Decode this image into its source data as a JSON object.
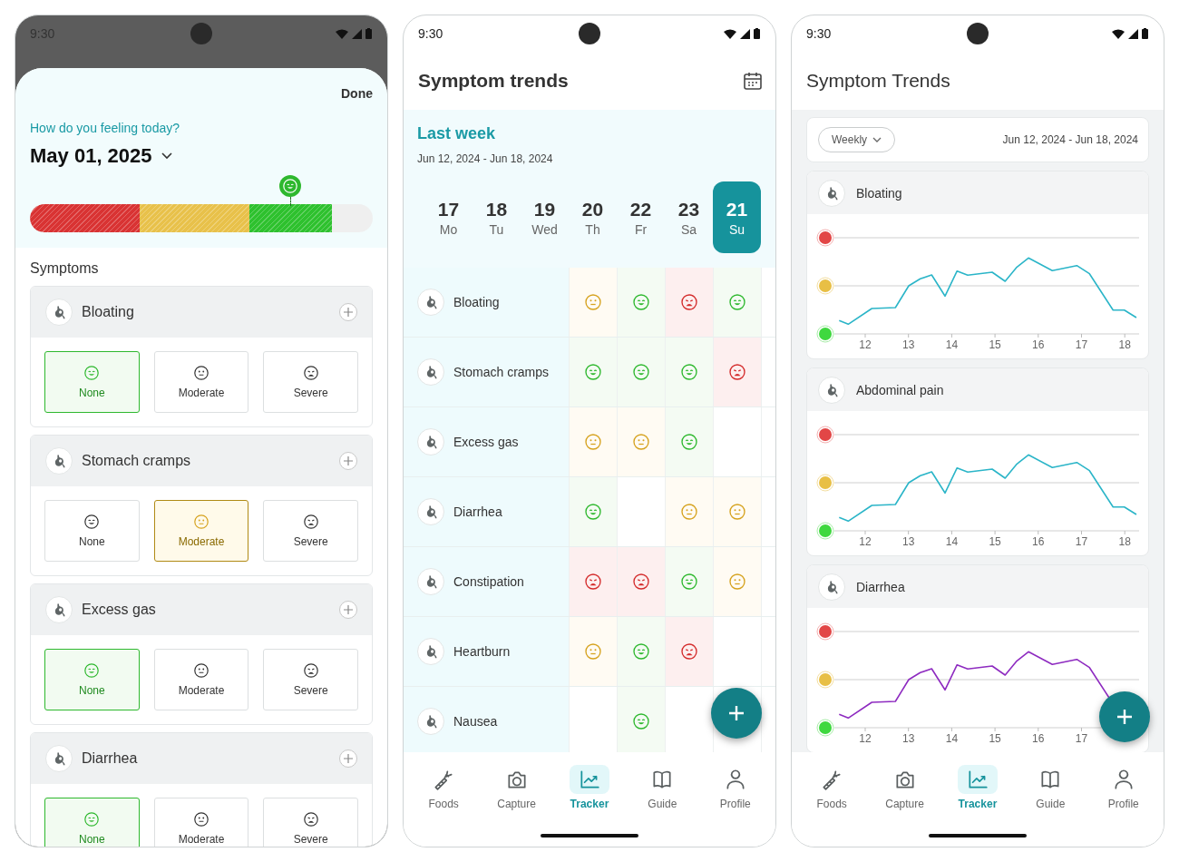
{
  "log_screen": {
    "status_bar": {
      "time": "9:30"
    },
    "done_button": "Done",
    "prompt": "How do you feeling today?",
    "date": "May 01, 2025",
    "mood_bar": {
      "level": 0.88
    },
    "section_title": "Symptoms",
    "symptoms": [
      {
        "name": "Bloating",
        "options": [
          {
            "kind": "none",
            "label": "None",
            "selected": true
          },
          {
            "kind": "moderate",
            "label": "Moderate",
            "selected": false
          },
          {
            "kind": "severe",
            "label": "Severe",
            "selected": false
          }
        ]
      },
      {
        "name": "Stomach cramps",
        "options": [
          {
            "kind": "none",
            "label": "None",
            "selected": false
          },
          {
            "kind": "moderate",
            "label": "Moderate",
            "selected": true
          },
          {
            "kind": "severe",
            "label": "Severe",
            "selected": false
          }
        ]
      },
      {
        "name": "Excess gas",
        "options": [
          {
            "kind": "none",
            "label": "None",
            "selected": true
          },
          {
            "kind": "moderate",
            "label": "Moderate",
            "selected": false
          },
          {
            "kind": "severe",
            "label": "Severe",
            "selected": false
          }
        ]
      },
      {
        "name": "Diarrhea",
        "options": [
          {
            "kind": "none",
            "label": "None",
            "selected": true
          },
          {
            "kind": "moderate",
            "label": "Moderate",
            "selected": false
          },
          {
            "kind": "severe",
            "label": "Severe",
            "selected": false
          }
        ]
      }
    ]
  },
  "grid_screen": {
    "status_bar": {
      "time": "9:30"
    },
    "title": "Symptom trends",
    "period_title": "Last week",
    "date_range": "Jun 12, 2024 - Jun 18, 2024",
    "days": [
      {
        "number": "17",
        "weekday": "Mo",
        "selected": false
      },
      {
        "number": "18",
        "weekday": "Tu",
        "selected": false
      },
      {
        "number": "19",
        "weekday": "Wed",
        "selected": false
      },
      {
        "number": "20",
        "weekday": "Th",
        "selected": false
      },
      {
        "number": "22",
        "weekday": "Fr",
        "selected": false
      },
      {
        "number": "23",
        "weekday": "Sa",
        "selected": false
      },
      {
        "number": "21",
        "weekday": "Su",
        "selected": true
      }
    ],
    "rows": [
      {
        "name": "Bloating",
        "cells": [
          {
            "kind": "moderate"
          },
          {
            "kind": "good"
          },
          {
            "kind": "severe"
          },
          {
            "kind": "good"
          }
        ]
      },
      {
        "name": "Stomach cramps",
        "cells": [
          {
            "kind": "good"
          },
          {
            "kind": "good"
          },
          {
            "kind": "good"
          },
          {
            "kind": "severe"
          }
        ]
      },
      {
        "name": "Excess gas",
        "cells": [
          {
            "kind": "moderate"
          },
          {
            "kind": "moderate"
          },
          {
            "kind": "good"
          },
          {
            "kind": "empty"
          }
        ]
      },
      {
        "name": "Diarrhea",
        "cells": [
          {
            "kind": "good"
          },
          {
            "kind": "empty"
          },
          {
            "kind": "moderate"
          },
          {
            "kind": "moderate"
          }
        ]
      },
      {
        "name": "Constipation",
        "cells": [
          {
            "kind": "severe"
          },
          {
            "kind": "severe"
          },
          {
            "kind": "good"
          },
          {
            "kind": "moderate"
          }
        ]
      },
      {
        "name": "Heartburn",
        "cells": [
          {
            "kind": "moderate"
          },
          {
            "kind": "good"
          },
          {
            "kind": "severe"
          },
          {
            "kind": "empty"
          }
        ]
      },
      {
        "name": "Nausea",
        "cells": [
          {
            "kind": "empty"
          },
          {
            "kind": "good"
          },
          {
            "kind": "empty"
          },
          {
            "kind": "empty"
          }
        ]
      }
    ],
    "nav": [
      {
        "kind": "foods",
        "label": "Foods",
        "selected": false
      },
      {
        "kind": "capture",
        "label": "Capture",
        "selected": false
      },
      {
        "kind": "tracker",
        "label": "Tracker",
        "selected": true
      },
      {
        "kind": "guide",
        "label": "Guide",
        "selected": false
      },
      {
        "kind": "profile",
        "label": "Profile",
        "selected": false
      }
    ]
  },
  "chart_screen": {
    "status_bar": {
      "time": "9:30"
    },
    "title": "Symptom Trends",
    "filter": {
      "period": "Weekly",
      "date_range": "Jun 12, 2024 - Jun 18, 2024"
    },
    "charts": [
      {
        "name": "Bloating",
        "color": "#2bb5c8",
        "xticks": [
          "12",
          "13",
          "14",
          "15",
          "16",
          "17",
          "18"
        ]
      },
      {
        "name": "Abdominal pain",
        "color": "#2bb5c8",
        "xticks": [
          "12",
          "13",
          "14",
          "15",
          "16",
          "17",
          "18"
        ]
      },
      {
        "name": "Diarrhea",
        "color": "#8e2bc0",
        "xticks": [
          "12",
          "13",
          "14",
          "15",
          "16",
          "17"
        ]
      }
    ],
    "nav": [
      {
        "kind": "foods",
        "label": "Foods",
        "selected": false
      },
      {
        "kind": "capture",
        "label": "Capture",
        "selected": false
      },
      {
        "kind": "tracker",
        "label": "Tracker",
        "selected": true
      },
      {
        "kind": "guide",
        "label": "Guide",
        "selected": false
      },
      {
        "kind": "profile",
        "label": "Profile",
        "selected": false
      }
    ]
  }
}
